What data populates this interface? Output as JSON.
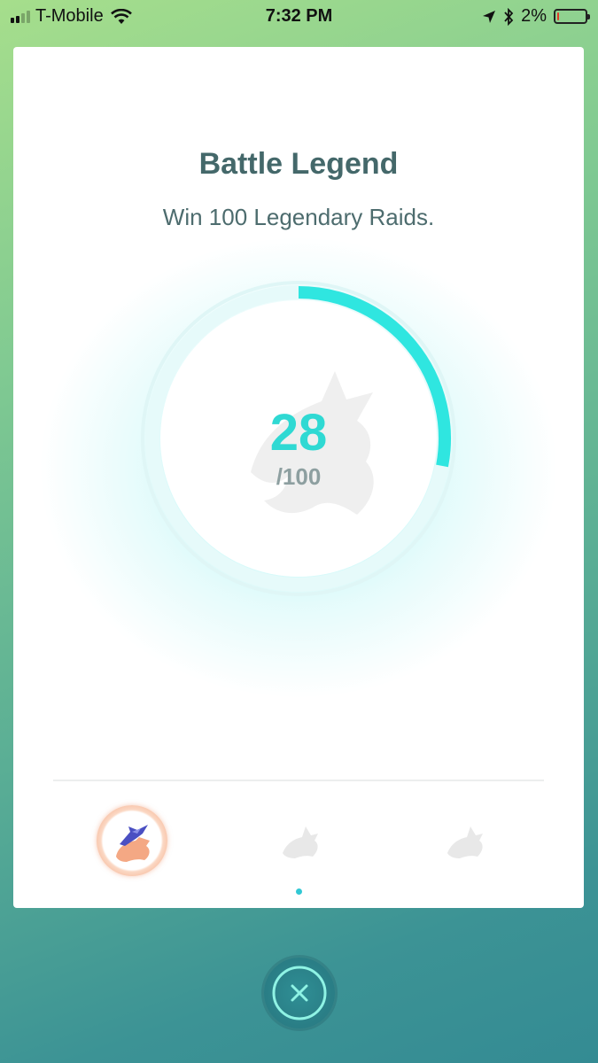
{
  "status_bar": {
    "carrier": "T-Mobile",
    "time": "7:32 PM",
    "battery": "2%",
    "battery_level": 0.02,
    "icons": [
      "signal-icon",
      "wifi-icon",
      "location-icon",
      "bluetooth-icon",
      "battery-icon"
    ]
  },
  "medal": {
    "title": "Battle Legend",
    "description": "Win 100 Legendary Raids.",
    "progress_value": "28",
    "progress_goal": "/100",
    "progress_fraction": 0.28,
    "accent_color": "#2fe6e0",
    "tiers": [
      {
        "name": "bronze",
        "unlocked": true,
        "icon": "dragon-bronze-medal-icon"
      },
      {
        "name": "silver",
        "unlocked": false,
        "icon": "dragon-silhouette-icon"
      },
      {
        "name": "gold",
        "unlocked": false,
        "icon": "dragon-silhouette-icon"
      }
    ],
    "page_index": 0
  },
  "close_button": {
    "icon": "close-icon"
  }
}
